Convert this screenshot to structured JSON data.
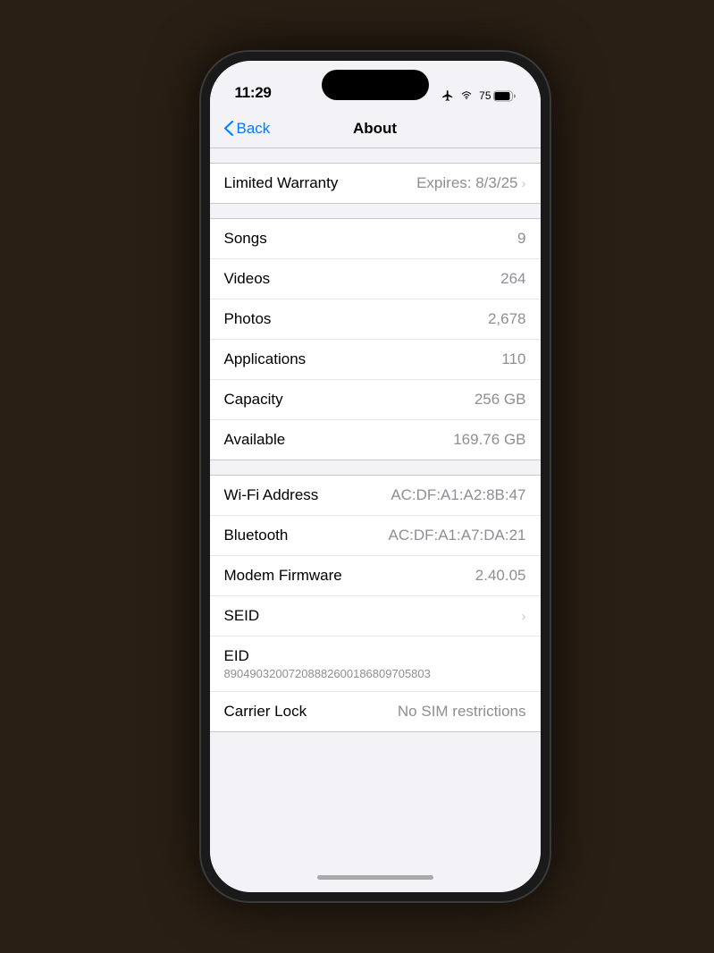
{
  "status_bar": {
    "time": "11:29",
    "battery_percent": "75",
    "icons": [
      "airplane",
      "wifi",
      "battery"
    ]
  },
  "nav": {
    "back_label": "Back",
    "title": "About"
  },
  "warranty": {
    "label": "Limited Warranty",
    "value": "Expires: 8/3/25"
  },
  "media_section": [
    {
      "label": "Songs",
      "value": "9"
    },
    {
      "label": "Videos",
      "value": "264"
    },
    {
      "label": "Photos",
      "value": "2,678"
    },
    {
      "label": "Applications",
      "value": "110"
    },
    {
      "label": "Capacity",
      "value": "256 GB"
    },
    {
      "label": "Available",
      "value": "169.76 GB"
    }
  ],
  "network_section": [
    {
      "label": "Wi-Fi Address",
      "value": "AC:DF:A1:A2:8B:47"
    },
    {
      "label": "Bluetooth",
      "value": "AC:DF:A1:A7:DA:21"
    },
    {
      "label": "Modem Firmware",
      "value": "2.40.05"
    },
    {
      "label": "SEID",
      "value": "",
      "chevron": true
    }
  ],
  "eid": {
    "label": "EID",
    "value": "89049032007208882600186809705803"
  },
  "carrier_lock": {
    "label": "Carrier Lock",
    "value": "No SIM restrictions"
  }
}
